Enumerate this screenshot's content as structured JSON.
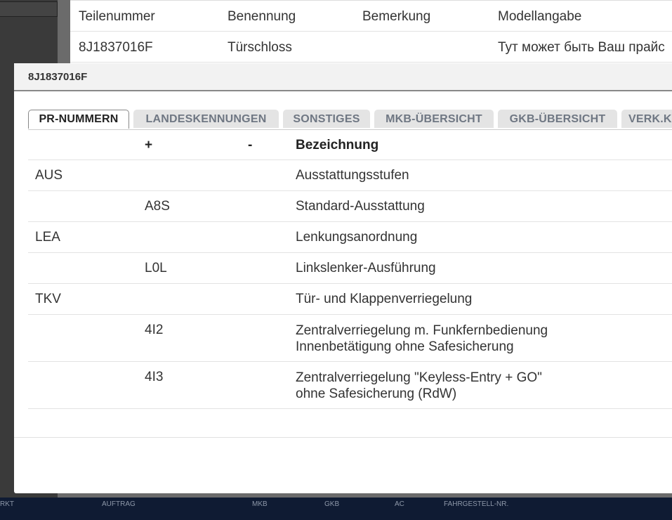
{
  "background_table": {
    "headers": [
      "Teilenummer",
      "Benennung",
      "Bemerkung",
      "Modellangabe"
    ],
    "row": [
      "8J1837016F",
      "Türschloss",
      "",
      "Тут может быть Ваш прайс"
    ]
  },
  "footer_bar": {
    "labels": [
      "RKT",
      "AUFTRAG",
      "MKB",
      "GKB",
      "AC",
      "FAHRGESTELL-NR."
    ]
  },
  "modal": {
    "title": "8J1837016F",
    "tabs": [
      {
        "label": "PR-NUMMERN",
        "active": true
      },
      {
        "label": "LANDESKENNUNGEN",
        "active": false
      },
      {
        "label": "SONSTIGES",
        "active": false
      },
      {
        "label": "MKB-ÜBERSICHT",
        "active": false
      },
      {
        "label": "GKB-ÜBERSICHT",
        "active": false
      },
      {
        "label": "VERK.K",
        "active": false
      }
    ],
    "table": {
      "headers": [
        "",
        "+",
        "-",
        "Bezeichnung"
      ],
      "rows": [
        {
          "group": "AUS",
          "plus": "",
          "minus": "",
          "desc": [
            "Ausstattungsstufen"
          ]
        },
        {
          "group": "",
          "plus": "A8S",
          "minus": "",
          "desc": [
            "Standard-Ausstattung"
          ]
        },
        {
          "group": "LEA",
          "plus": "",
          "minus": "",
          "desc": [
            "Lenkungsanordnung"
          ]
        },
        {
          "group": "",
          "plus": "L0L",
          "minus": "",
          "desc": [
            "Linkslenker-Ausführung"
          ]
        },
        {
          "group": "TKV",
          "plus": "",
          "minus": "",
          "desc": [
            "Tür- und Klappenverriegelung"
          ]
        },
        {
          "group": "",
          "plus": "4I2",
          "minus": "",
          "desc": [
            "Zentralverriegelung m. Funkfernbedienung",
            "Innenbetätigung ohne Safesicherung"
          ]
        },
        {
          "group": "",
          "plus": "4I3",
          "minus": "",
          "desc": [
            "Zentralverriegelung \"Keyless-Entry + GO\"",
            "ohne Safesicherung (RdW)"
          ]
        }
      ]
    }
  }
}
